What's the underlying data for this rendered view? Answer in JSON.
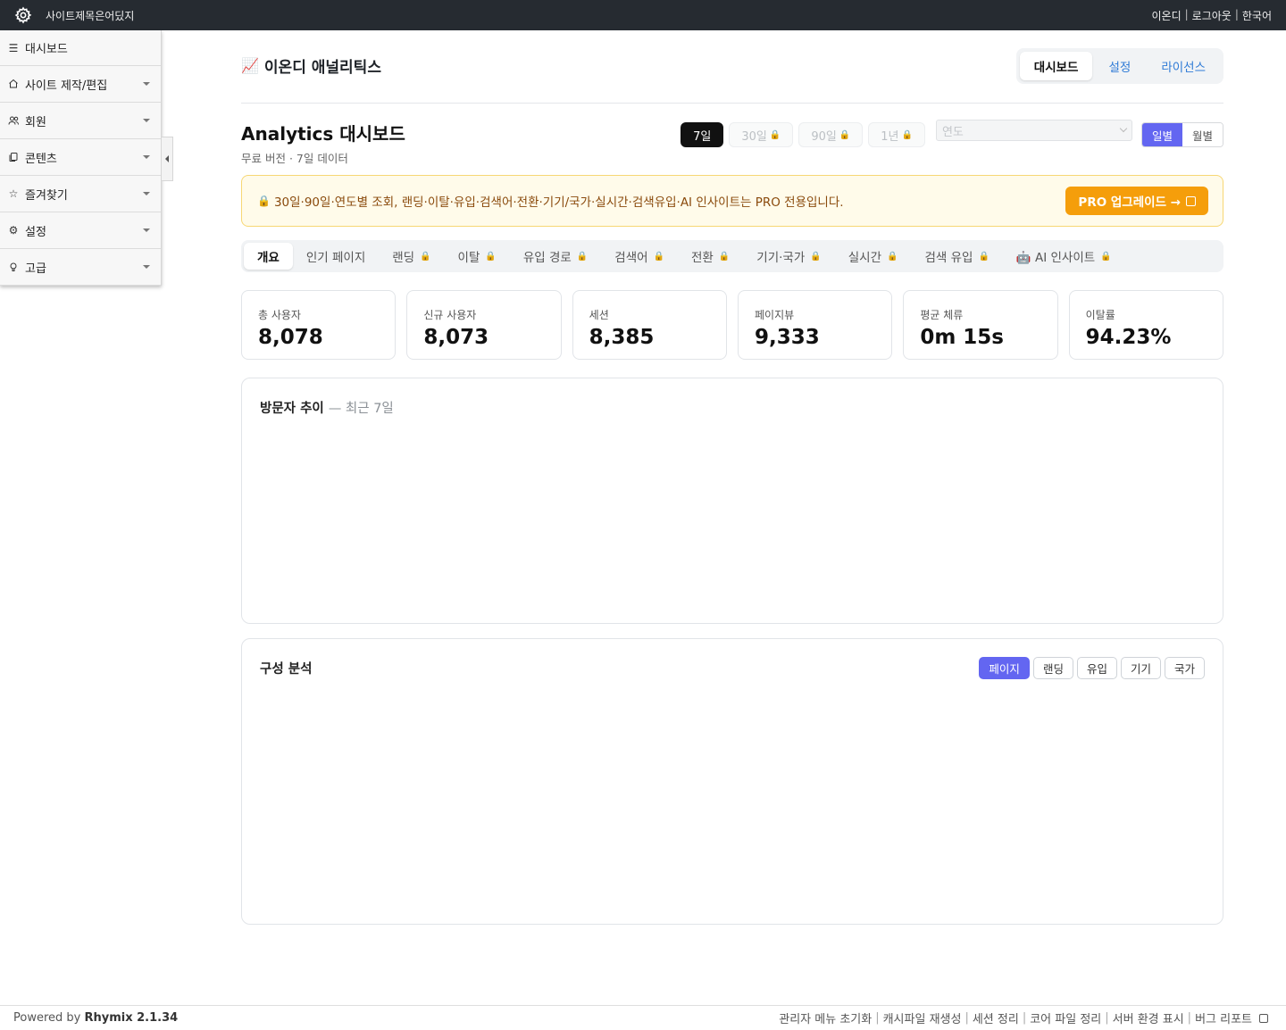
{
  "topbar": {
    "site_title": "사이트제목은어딨지",
    "links": [
      "이온디",
      "로그아웃",
      "한국어"
    ]
  },
  "sidebar": {
    "items": [
      {
        "label": "대시보드",
        "icon": "hamburger-icon"
      },
      {
        "label": "사이트 제작/편집",
        "icon": "home-icon"
      },
      {
        "label": "회원",
        "icon": "users-icon"
      },
      {
        "label": "콘텐츠",
        "icon": "copy-icon"
      },
      {
        "label": "즐겨찾기",
        "icon": "star-icon"
      },
      {
        "label": "설정",
        "icon": "gear-icon"
      },
      {
        "label": "고급",
        "icon": "lightbulb-icon"
      }
    ]
  },
  "header": {
    "app_icon": "📈",
    "app_title": "이온디 애널리틱스",
    "tabs": [
      {
        "label": "대시보드",
        "active": true
      },
      {
        "label": "설정",
        "active": false
      },
      {
        "label": "라이선스",
        "active": false
      }
    ]
  },
  "dashboard": {
    "title": "Analytics 대시보드",
    "subtitle": "무료 버전 · 7일 데이터",
    "ranges": [
      {
        "label": "7일",
        "active": true,
        "locked": false
      },
      {
        "label": "30일",
        "active": false,
        "locked": true
      },
      {
        "label": "90일",
        "active": false,
        "locked": true
      },
      {
        "label": "1년",
        "active": false,
        "locked": true
      }
    ],
    "year_placeholder": "연도",
    "granularity": [
      {
        "label": "일별",
        "active": true
      },
      {
        "label": "월별",
        "active": false
      }
    ]
  },
  "banner": {
    "lock": "🔒",
    "text": "30일·90일·연도별 조회, 랜딩·이탈·유입·검색어·전환·기기/국가·실시간·검색유입·AI 인사이트는 PRO 전용입니다.",
    "button": "PRO 업그레이드 →"
  },
  "subtabs": [
    {
      "label": "개요",
      "active": true,
      "locked": false
    },
    {
      "label": "인기 페이지",
      "active": false,
      "locked": false
    },
    {
      "label": "랜딩",
      "active": false,
      "locked": true
    },
    {
      "label": "이탈",
      "active": false,
      "locked": true
    },
    {
      "label": "유입 경로",
      "active": false,
      "locked": true
    },
    {
      "label": "검색어",
      "active": false,
      "locked": true
    },
    {
      "label": "전환",
      "active": false,
      "locked": true
    },
    {
      "label": "기기·국가",
      "active": false,
      "locked": true
    },
    {
      "label": "실시간",
      "active": false,
      "locked": true
    },
    {
      "label": "검색 유입",
      "active": false,
      "locked": true
    },
    {
      "label": "🤖 AI 인사이트",
      "active": false,
      "locked": true
    }
  ],
  "kpis": [
    {
      "label": "총 사용자",
      "value": "8,078"
    },
    {
      "label": "신규 사용자",
      "value": "8,073"
    },
    {
      "label": "세션",
      "value": "8,385"
    },
    {
      "label": "페이지뷰",
      "value": "9,333"
    },
    {
      "label": "평균 체류",
      "value": "0m 15s"
    },
    {
      "label": "이탈률",
      "value": "94.23%"
    }
  ],
  "trend_card": {
    "title": "방문자 추이",
    "subtitle": "— 최근 7일"
  },
  "composition_card": {
    "title": "구성 분석",
    "tabs": [
      {
        "label": "페이지",
        "active": true
      },
      {
        "label": "랜딩",
        "active": false
      },
      {
        "label": "유입",
        "active": false
      },
      {
        "label": "기기",
        "active": false
      },
      {
        "label": "국가",
        "active": false
      }
    ]
  },
  "footer": {
    "powered_prefix": "Powered by ",
    "powered_name": "Rhymix 2.1.34",
    "links": [
      "관리자 메뉴 초기화",
      "캐시파일 재생성",
      "세션 정리",
      "코어 파일 정리",
      "서버 환경 표시",
      "버그 리포트"
    ]
  },
  "colors": {
    "topbar": "#262b31",
    "accent": "#6366f1",
    "pro_button": "#f59e0b",
    "banner_bg": "#fffbea",
    "link_blue": "#2f7bd6"
  }
}
